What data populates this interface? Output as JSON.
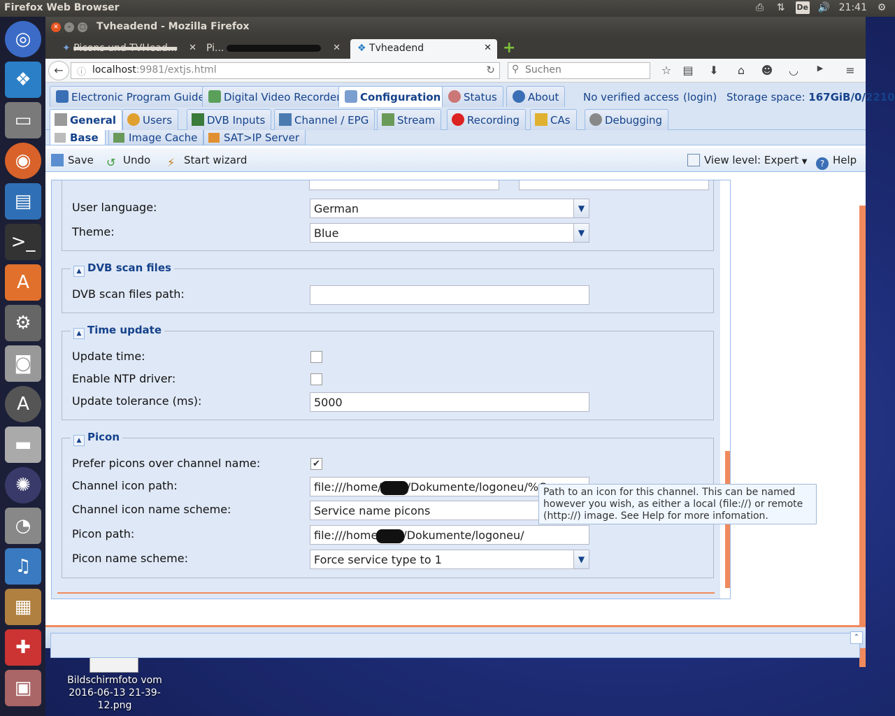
{
  "os": {
    "panel_title": "Firefox Web Browser",
    "keyboard_layout": "De",
    "clock": "21:41"
  },
  "desktop": {
    "file_label": "Bildschirmfoto vom 2016-06-13 21-39-12.png"
  },
  "window": {
    "title": "Tvheadend - Mozilla Firefox"
  },
  "tabs": [
    {
      "label": "Picons und TVHead..."
    },
    {
      "label": "Pi..."
    },
    {
      "label": "Tvheadend"
    }
  ],
  "nav": {
    "url_host": "localhost",
    "url_port": ":9981",
    "url_path": "/extjs.html",
    "search_placeholder": "Suchen"
  },
  "main_tabs": {
    "epg": "Electronic Program Guide",
    "dvr": "Digital Video Recorder",
    "config": "Configuration",
    "status": "Status",
    "about": "About",
    "access": "No verified access",
    "login": "(login)",
    "storage_label": "Storage space:",
    "storage_value": "167GiB/0/2210"
  },
  "sub_tabs": {
    "general": "General",
    "users": "Users",
    "dvb": "DVB Inputs",
    "channel": "Channel / EPG",
    "stream": "Stream",
    "recording": "Recording",
    "cas": "CAs",
    "debugging": "Debugging"
  },
  "base_tabs": {
    "base": "Base",
    "image_cache": "Image Cache",
    "satip": "SAT>IP Server"
  },
  "toolbar": {
    "save": "Save",
    "undo": "Undo",
    "wizard": "Start wizard",
    "view_level": "View level: Expert",
    "help": "Help"
  },
  "form": {
    "user_language_label": "User language:",
    "user_language_value": "German",
    "theme_label": "Theme:",
    "theme_value": "Blue",
    "dvb_section": "DVB scan files",
    "dvb_path_label": "DVB scan files path:",
    "dvb_path_value": "",
    "time_section": "Time update",
    "update_time_label": "Update time:",
    "update_time_checked": false,
    "ntp_label": "Enable NTP driver:",
    "ntp_checked": false,
    "tolerance_label": "Update tolerance (ms):",
    "tolerance_value": "5000",
    "picon_section": "Picon",
    "prefer_label": "Prefer picons over channel name:",
    "prefer_checked": true,
    "icon_path_label": "Channel icon path:",
    "icon_path_prefix": "file:///home/",
    "icon_path_suffix": "/Dokumente/logoneu/%C.png",
    "icon_scheme_label": "Channel icon name scheme:",
    "icon_scheme_value": "Service name picons",
    "picon_path_label": "Picon path:",
    "picon_path_prefix": "file:///home",
    "picon_path_suffix": "/Dokumente/logoneu/",
    "picon_scheme_label": "Picon name scheme:",
    "picon_scheme_value": "Force service type to 1"
  },
  "tooltip": "Path to an icon for this channel. This can be named however you wish, as either a local (file://) or remote (http://) image. See Help for more infomation.",
  "colors": {
    "ext_blue": "#15428b",
    "panel_bg": "#dfe8f6",
    "accent_orange": "#f08a5d"
  }
}
